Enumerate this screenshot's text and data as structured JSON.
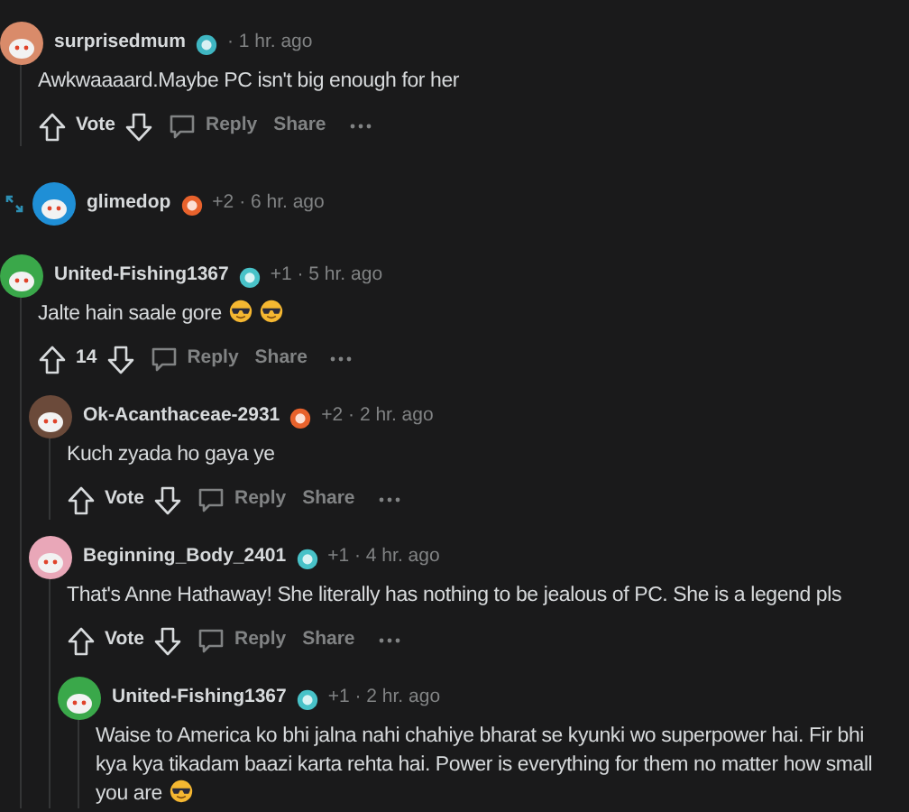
{
  "comments": [
    {
      "author": "surprisedmum",
      "color": "#d98b6a",
      "badge": {
        "color": "#3fb6c2"
      },
      "time": "· 1 hr. ago",
      "collapsed": false,
      "text": "Awkwaaaard.Maybe PC isn't big enough for her",
      "actions": {
        "score": "Vote",
        "reply": "Reply",
        "share": "Share"
      }
    },
    {
      "author": "glimedop",
      "color": "#1f8fd6",
      "badge": {
        "color": "#e8622c"
      },
      "flair": "+2",
      "time": "· 6 hr. ago",
      "collapsed": true
    },
    {
      "author": "United-Fishing1367",
      "color": "#3aa84a",
      "badge": {
        "color": "#48c2c8"
      },
      "flair": "+1",
      "time": "· 5 hr. ago",
      "collapsed": false,
      "text": "Jalte hain saale gore",
      "emojis": [
        {
          "kind": "sunglasses"
        },
        {
          "kind": "sunglasses"
        }
      ],
      "actions": {
        "score": "14",
        "reply": "Reply",
        "share": "Share"
      },
      "children": [
        {
          "author": "Ok-Acanthaceae-2931",
          "color": "#6b4a3a",
          "badge": {
            "color": "#e8622c"
          },
          "flair": "+2",
          "time": "· 2 hr. ago",
          "collapsed": false,
          "text": "Kuch zyada ho gaya ye",
          "actions": {
            "score": "Vote",
            "reply": "Reply",
            "share": "Share"
          }
        },
        {
          "author": "Beginning_Body_2401",
          "color": "#e9a7b8",
          "badge": {
            "color": "#48c2c8"
          },
          "flair": "+1",
          "time": "· 4 hr. ago",
          "collapsed": false,
          "text": "That's Anne Hathaway! She literally has nothing to be jealous of PC. She is a legend pls",
          "actions": {
            "score": "Vote",
            "reply": "Reply",
            "share": "Share"
          },
          "children": [
            {
              "author": "United-Fishing1367",
              "color": "#3aa84a",
              "badge": {
                "color": "#48c2c8"
              },
              "flair": "+1",
              "time": "· 2 hr. ago",
              "collapsed": false,
              "text": "Waise to America ko bhi jalna nahi chahiye bharat se kyunki wo superpower hai. Fir bhi kya kya tikadam baazi karta rehta hai. Power is everything for them no matter how small you are",
              "emojis": [
                {
                  "kind": "sunglasses"
                }
              ]
            }
          ]
        }
      ]
    }
  ]
}
